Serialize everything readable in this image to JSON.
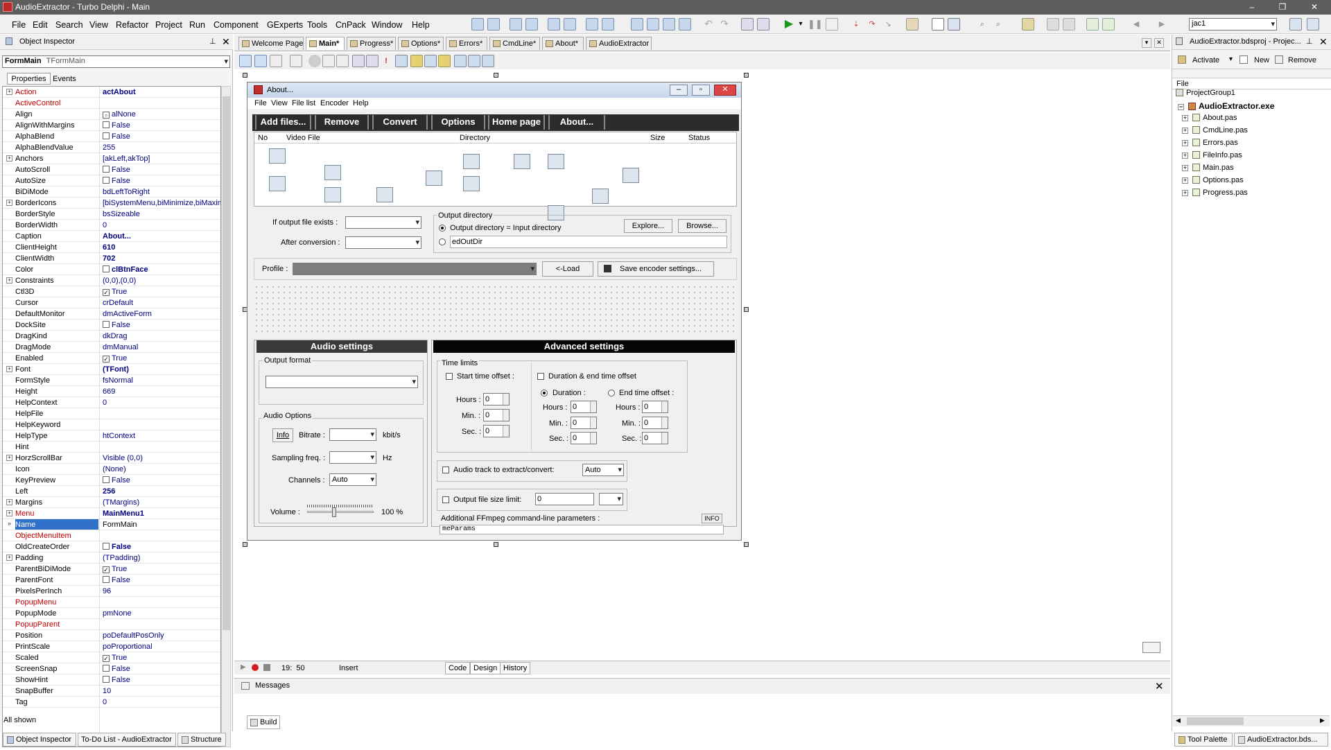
{
  "window": {
    "title": "AudioExtractor - Turbo Delphi - Main",
    "search_value": "jac1"
  },
  "menu": [
    "File",
    "Edit",
    "Search",
    "View",
    "Refactor",
    "Project",
    "Run",
    "Component",
    "GExperts",
    "Tools",
    "CnPack",
    "Window",
    "Help"
  ],
  "object_inspector": {
    "title": "Object Inspector",
    "selected_object": "FormMain",
    "selected_type": "TFormMain",
    "tabs": [
      "Properties",
      "Events"
    ],
    "status": "All shown",
    "rows": [
      {
        "name": "Action",
        "value": "actAbout",
        "expand": "+",
        "red": true,
        "bold": true
      },
      {
        "name": "ActiveControl",
        "value": "",
        "red": true
      },
      {
        "name": "Align",
        "value": "alNone",
        "check": "▫"
      },
      {
        "name": "AlignWithMargins",
        "value": "False",
        "check": " "
      },
      {
        "name": "AlphaBlend",
        "value": "False",
        "check": " "
      },
      {
        "name": "AlphaBlendValue",
        "value": "255"
      },
      {
        "name": "Anchors",
        "value": "[akLeft,akTop]",
        "expand": "+"
      },
      {
        "name": "AutoScroll",
        "value": "False",
        "check": " "
      },
      {
        "name": "AutoSize",
        "value": "False",
        "check": " "
      },
      {
        "name": "BiDiMode",
        "value": "bdLeftToRight"
      },
      {
        "name": "BorderIcons",
        "value": "[biSystemMenu,biMinimize,biMaximiz",
        "expand": "+"
      },
      {
        "name": "BorderStyle",
        "value": "bsSizeable"
      },
      {
        "name": "BorderWidth",
        "value": "0"
      },
      {
        "name": "Caption",
        "value": "About...",
        "bold": true
      },
      {
        "name": "ClientHeight",
        "value": "610",
        "bold": true
      },
      {
        "name": "ClientWidth",
        "value": "702",
        "bold": true
      },
      {
        "name": "Color",
        "value": "clBtnFace",
        "check": " ",
        "bold": true
      },
      {
        "name": "Constraints",
        "value": "(0,0),(0,0)",
        "expand": "+"
      },
      {
        "name": "Ctl3D",
        "value": "True",
        "check": "✓"
      },
      {
        "name": "Cursor",
        "value": "crDefault"
      },
      {
        "name": "DefaultMonitor",
        "value": "dmActiveForm"
      },
      {
        "name": "DockSite",
        "value": "False",
        "check": " "
      },
      {
        "name": "DragKind",
        "value": "dkDrag"
      },
      {
        "name": "DragMode",
        "value": "dmManual"
      },
      {
        "name": "Enabled",
        "value": "True",
        "check": "✓"
      },
      {
        "name": "Font",
        "value": "(TFont)",
        "expand": "+",
        "bold": true
      },
      {
        "name": "FormStyle",
        "value": "fsNormal"
      },
      {
        "name": "Height",
        "value": "669"
      },
      {
        "name": "HelpContext",
        "value": "0"
      },
      {
        "name": "HelpFile",
        "value": ""
      },
      {
        "name": "HelpKeyword",
        "value": ""
      },
      {
        "name": "HelpType",
        "value": "htContext"
      },
      {
        "name": "Hint",
        "value": ""
      },
      {
        "name": "HorzScrollBar",
        "value": "Visible (0,0)",
        "expand": "+"
      },
      {
        "name": "Icon",
        "value": "(None)"
      },
      {
        "name": "KeyPreview",
        "value": "False",
        "check": " "
      },
      {
        "name": "Left",
        "value": "256",
        "bold": true
      },
      {
        "name": "Margins",
        "value": "(TMargins)",
        "expand": "+"
      },
      {
        "name": "Menu",
        "value": "MainMenu1",
        "expand": "+",
        "red": true,
        "bold": true
      },
      {
        "name": "Name",
        "value": "FormMain",
        "selected": true,
        "expand": "»"
      },
      {
        "name": "ObjectMenuItem",
        "value": "",
        "red": true
      },
      {
        "name": "OldCreateOrder",
        "value": "False",
        "check": " ",
        "bold": true
      },
      {
        "name": "Padding",
        "value": "(TPadding)",
        "expand": "+"
      },
      {
        "name": "ParentBiDiMode",
        "value": "True",
        "check": "✓"
      },
      {
        "name": "ParentFont",
        "value": "False",
        "check": " "
      },
      {
        "name": "PixelsPerInch",
        "value": "96"
      },
      {
        "name": "PopupMenu",
        "value": "",
        "red": true
      },
      {
        "name": "PopupMode",
        "value": "pmNone"
      },
      {
        "name": "PopupParent",
        "value": "",
        "red": true
      },
      {
        "name": "Position",
        "value": "poDefaultPosOnly"
      },
      {
        "name": "PrintScale",
        "value": "poProportional"
      },
      {
        "name": "Scaled",
        "value": "True",
        "check": "✓"
      },
      {
        "name": "ScreenSnap",
        "value": "False",
        "check": " "
      },
      {
        "name": "ShowHint",
        "value": "False",
        "check": " "
      },
      {
        "name": "SnapBuffer",
        "value": "10"
      },
      {
        "name": "Tag",
        "value": "0"
      }
    ]
  },
  "editor_tabs": [
    {
      "label": "Welcome Page",
      "active": false
    },
    {
      "label": "Main*",
      "active": true
    },
    {
      "label": "Progress*",
      "active": false
    },
    {
      "label": "Options*",
      "active": false
    },
    {
      "label": "Errors*",
      "active": false
    },
    {
      "label": "CmdLine*",
      "active": false
    },
    {
      "label": "About*",
      "active": false
    },
    {
      "label": "AudioExtractor",
      "active": false
    }
  ],
  "form": {
    "caption": "About...",
    "menu": [
      "File",
      "View",
      "File list",
      "Encoder",
      "Help"
    ],
    "toolbar_buttons": [
      "Add files...",
      "Remove",
      "Convert",
      "Options",
      "Home page",
      "About..."
    ],
    "list_columns": [
      "No",
      "Video File",
      "Directory",
      "Size",
      "Status"
    ],
    "if_exists_label": "If output file exists :",
    "after_conversion_label": "After conversion :",
    "output_dir": {
      "title": "Output directory",
      "radio_input": "Output directory = Input directory",
      "edit_value": "edOutDir",
      "explore": "Explore...",
      "browse": "Browse..."
    },
    "profile_label": "Profile :",
    "load_btn": "<-Load",
    "save_btn": "Save encoder settings...",
    "audio_settings": {
      "header": "Audio settings",
      "output_format": "Output format",
      "audio_options": "Audio Options",
      "info_btn": "Info",
      "bitrate_label": "Bitrate :",
      "bitrate_unit": "kbit/s",
      "sampling_label": "Sampling freq. :",
      "sampling_unit": "Hz",
      "channels_label": "Channels :",
      "channels_value": "Auto",
      "volume_label": "Volume :",
      "volume_value": "100 %",
      "volume_level": 0.4
    },
    "advanced": {
      "header": "Advanced settings",
      "time_limits": "Time limits",
      "start_offset": "Start time offset :",
      "duration_end": "Duration & end time offset",
      "duration": "Duration :",
      "end_offset": "End time offset :",
      "hours": "Hours :",
      "min": "Min. :",
      "sec": "Sec. :",
      "zero": "0",
      "audio_track": "Audio track to extract/convert:",
      "audio_track_value": "Auto",
      "size_limit": "Output file size limit:",
      "size_limit_value": "0",
      "ffmpeg_label": "Additional FFmpeg command-line parameters :",
      "info": "INFO",
      "ffmpeg_value": "meParams"
    }
  },
  "project_manager": {
    "title": "AudioExtractor.bdsproj - Projec...",
    "activate": "Activate",
    "new": "New",
    "remove": "Remove",
    "column": "File",
    "group": "ProjectGroup1",
    "exe": "AudioExtractor.exe",
    "files": [
      "About.pas",
      "CmdLine.pas",
      "Errors.pas",
      "FileInfo.pas",
      "Main.pas",
      "Options.pas",
      "Progress.pas"
    ]
  },
  "editor_status": {
    "position": "19:  50",
    "mode": "Insert",
    "tabs": [
      "Code",
      "Design",
      "History"
    ]
  },
  "messages": {
    "title": "Messages",
    "build_tab": "Build"
  },
  "bottom_tabs": {
    "left": [
      "Object Inspector",
      "To-Do List - AudioExtractor",
      "Structure"
    ],
    "right": [
      "Tool Palette",
      "AudioExtractor.bds..."
    ]
  }
}
